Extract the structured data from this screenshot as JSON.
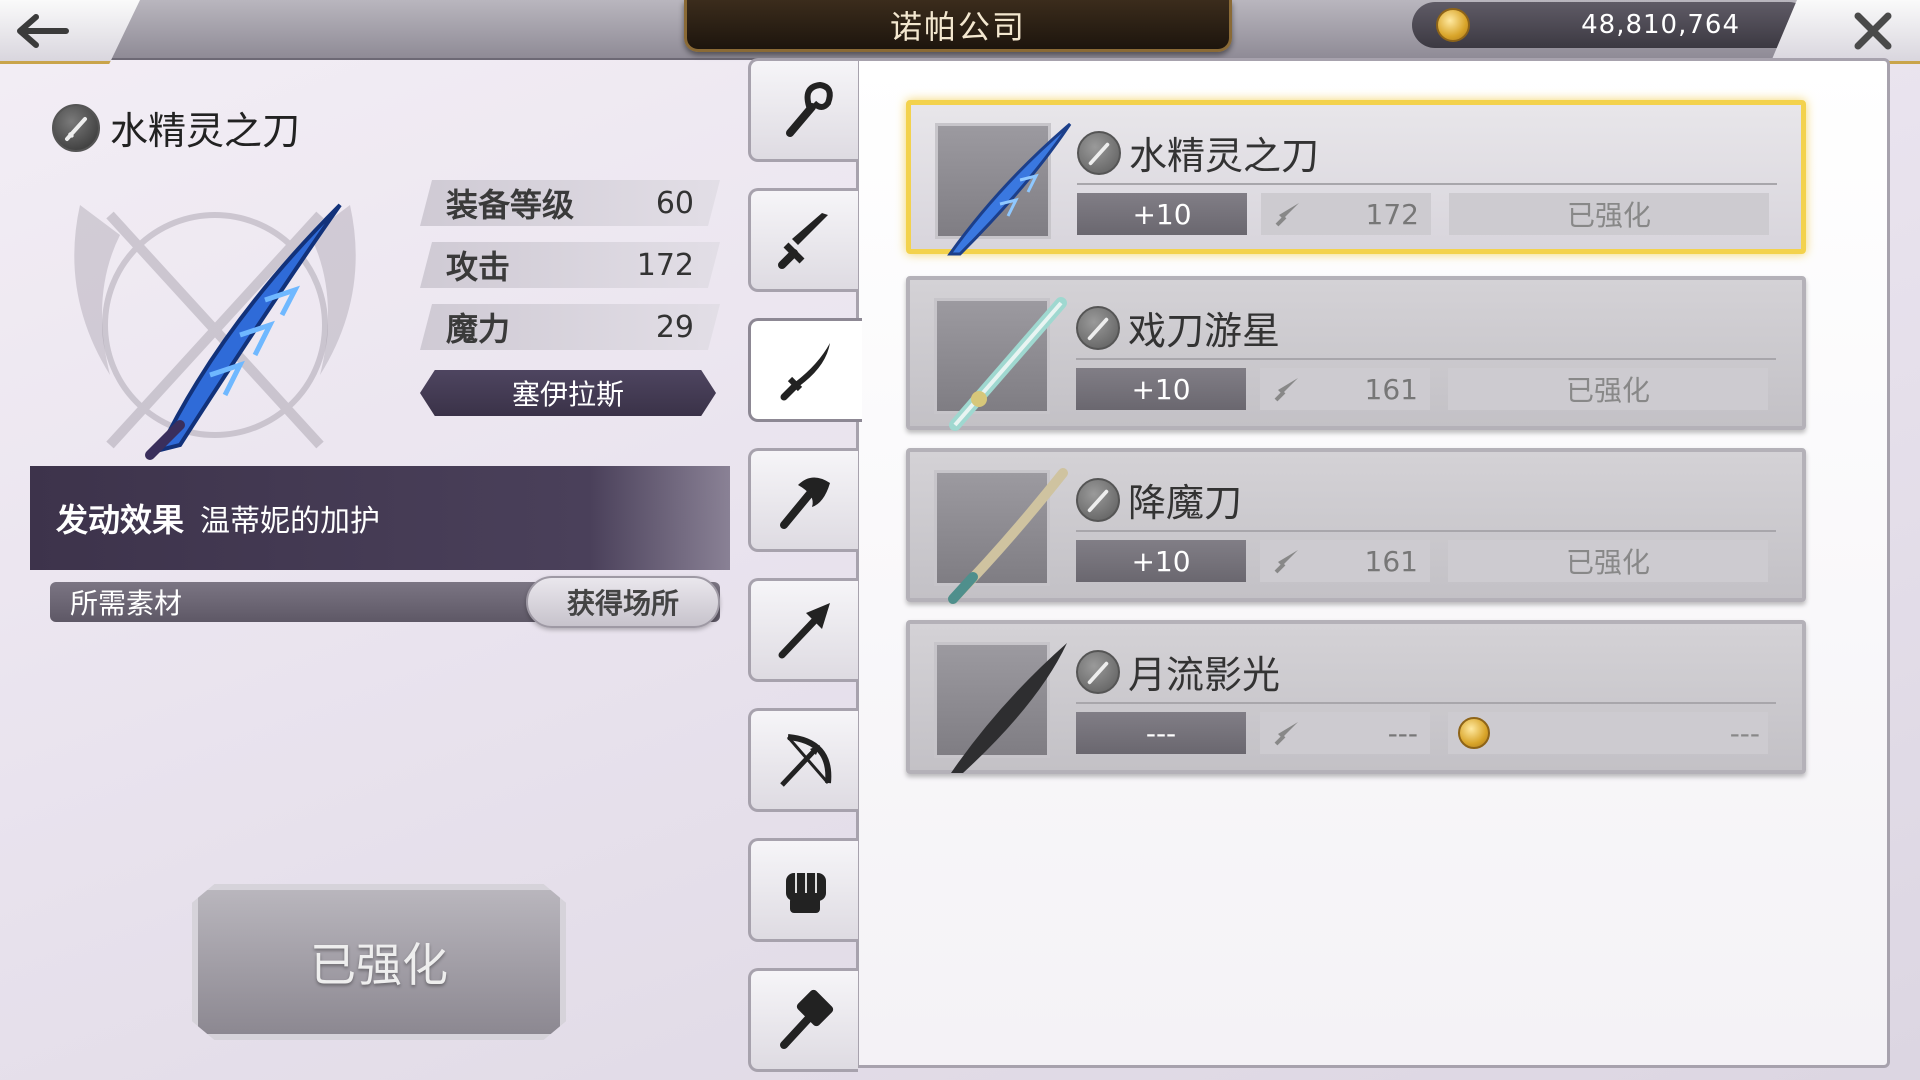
{
  "header": {
    "title": "诺帕公司",
    "coins": "48,810,764",
    "back_icon": "back-arrow-icon",
    "close_icon": "close-icon"
  },
  "detail": {
    "name": "水精灵之刀",
    "stats": [
      {
        "label": "装备等级",
        "value": "60"
      },
      {
        "label": "攻击",
        "value": "172"
      },
      {
        "label": "魔力",
        "value": "29"
      }
    ],
    "character": "塞伊拉斯",
    "effect_label": "发动效果",
    "effect_value": "温蒂妮的加护",
    "material_label": "所需素材",
    "source_button": "获得场所",
    "enhance_button": "已强化"
  },
  "tabs": [
    {
      "name": "staff-icon",
      "active": false
    },
    {
      "name": "sword-icon",
      "active": false
    },
    {
      "name": "katana-icon",
      "active": true
    },
    {
      "name": "axe-icon",
      "active": false
    },
    {
      "name": "spear-icon",
      "active": false
    },
    {
      "name": "bow-icon",
      "active": false
    },
    {
      "name": "fist-icon",
      "active": false
    },
    {
      "name": "hammer-icon",
      "active": false
    }
  ],
  "weapons": [
    {
      "name": "水精灵之刀",
      "level": "+10",
      "attack": "172",
      "status": "已强化",
      "selected": true
    },
    {
      "name": "戏刀游星",
      "level": "+10",
      "attack": "161",
      "status": "已强化",
      "selected": false
    },
    {
      "name": "降魔刀",
      "level": "+10",
      "attack": "161",
      "status": "已强化",
      "selected": false
    },
    {
      "name": "月流影光",
      "level": "---",
      "attack": "---",
      "status": "---",
      "selected": false,
      "locked": true
    }
  ]
}
